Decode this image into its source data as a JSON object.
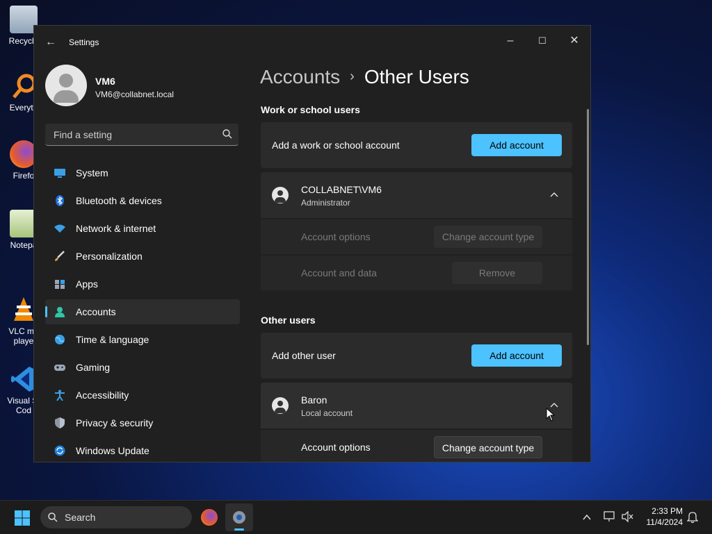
{
  "desktop": {
    "icons": [
      {
        "label": "Recycle",
        "icon": "recycle-bin-icon"
      },
      {
        "label": "Everyth",
        "icon": "everything-search-icon"
      },
      {
        "label": "Firefo",
        "icon": "firefox-icon"
      },
      {
        "label": "Notepa",
        "icon": "notepad-icon"
      },
      {
        "label": "VLC me\nplaye",
        "icon": "vlc-icon"
      },
      {
        "label": "Visual St\nCod",
        "icon": "vscode-icon"
      }
    ]
  },
  "window": {
    "title": "Settings",
    "controls": {
      "minimize": "–",
      "maximize": "☐",
      "close": "✕"
    }
  },
  "profile": {
    "name": "VM6",
    "email": "VM6@collabnet.local"
  },
  "search": {
    "placeholder": "Find a setting"
  },
  "nav": {
    "items": [
      {
        "label": "System",
        "icon": "system-icon",
        "active": false
      },
      {
        "label": "Bluetooth & devices",
        "icon": "bluetooth-icon",
        "active": false
      },
      {
        "label": "Network & internet",
        "icon": "wifi-icon",
        "active": false
      },
      {
        "label": "Personalization",
        "icon": "brush-icon",
        "active": false
      },
      {
        "label": "Apps",
        "icon": "apps-icon",
        "active": false
      },
      {
        "label": "Accounts",
        "icon": "person-icon",
        "active": true
      },
      {
        "label": "Time & language",
        "icon": "globe-icon",
        "active": false
      },
      {
        "label": "Gaming",
        "icon": "gamepad-icon",
        "active": false
      },
      {
        "label": "Accessibility",
        "icon": "accessibility-icon",
        "active": false
      },
      {
        "label": "Privacy & security",
        "icon": "shield-icon",
        "active": false
      },
      {
        "label": "Windows Update",
        "icon": "update-icon",
        "active": false
      }
    ]
  },
  "breadcrumb": {
    "parent": "Accounts",
    "separator": "›",
    "current": "Other Users"
  },
  "work_section": {
    "heading": "Work or school users",
    "add_text": "Add a work or school account",
    "add_button": "Add account",
    "user": {
      "name": "COLLABNET\\VM6",
      "role": "Administrator",
      "options_label": "Account options",
      "options_button": "Change account type",
      "data_label": "Account and data",
      "data_button": "Remove"
    }
  },
  "other_section": {
    "heading": "Other users",
    "add_text": "Add other user",
    "add_button": "Add account",
    "user": {
      "name": "Baron",
      "role": "Local account",
      "options_label": "Account options",
      "options_button": "Change account type"
    }
  },
  "taskbar": {
    "search_label": "Search",
    "time": "2:33 PM",
    "date": "11/4/2024"
  },
  "colors": {
    "accent": "#4cc2ff",
    "window_bg": "#202020",
    "card_bg": "#2b2b2b"
  }
}
